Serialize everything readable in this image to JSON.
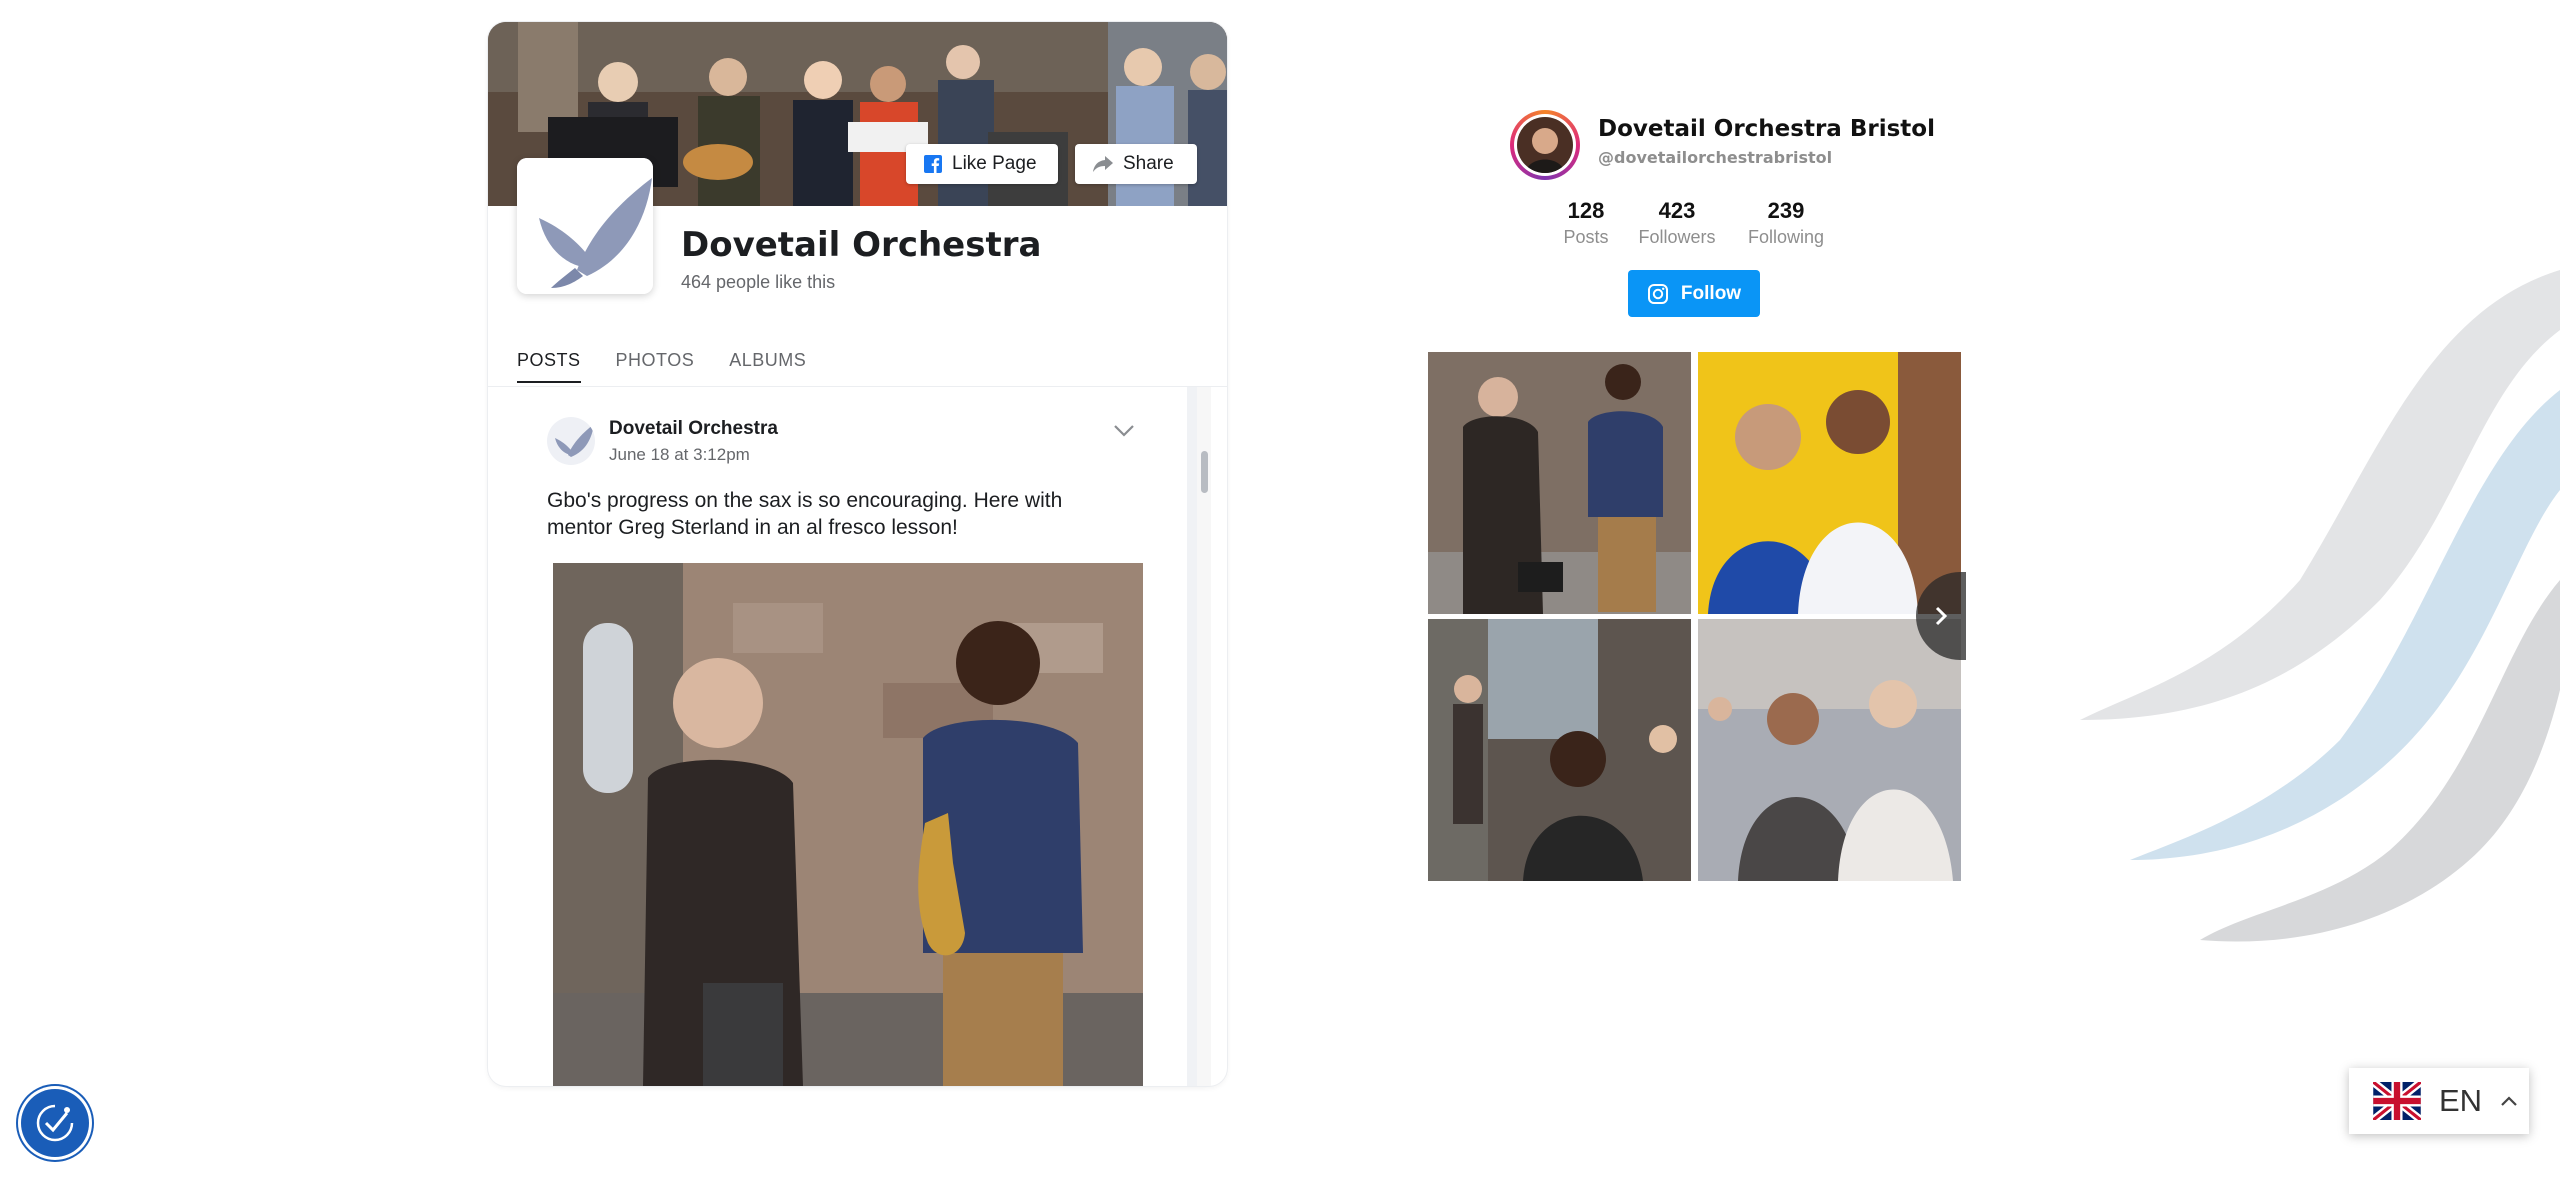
{
  "facebook": {
    "page_name": "Dovetail Orchestra",
    "likes_text": "464 people like this",
    "like_button": "Like Page",
    "share_button": "Share",
    "tabs": [
      "POSTS",
      "PHOTOS",
      "ALBUMS"
    ],
    "active_tab": "POSTS",
    "post": {
      "author": "Dovetail Orchestra",
      "date": "June 18 at 3:12pm",
      "text": "Gbo's progress on the sax is so encouraging. Here with mentor Greg Sterland in an al fresco lesson!"
    },
    "brand_color": "#1877f2"
  },
  "instagram": {
    "name": "Dovetail Orchestra Bristol",
    "handle": "@dovetailorchestrabristol",
    "stats": [
      {
        "value": "128",
        "label": "Posts"
      },
      {
        "value": "423",
        "label": "Followers"
      },
      {
        "value": "239",
        "label": "Following"
      }
    ],
    "follow_button": "Follow",
    "accent_color": "#0a95f6"
  },
  "icons": {
    "like": "facebook-f-icon",
    "share": "share-arrow-icon",
    "chevron": "chevron-down-icon",
    "instagram": "instagram-icon",
    "next": "chevron-right-icon",
    "accessibility": "accessibility-icon",
    "flag": "uk-flag-icon",
    "lang_chevron": "chevron-up-icon"
  },
  "language": {
    "code": "EN"
  }
}
